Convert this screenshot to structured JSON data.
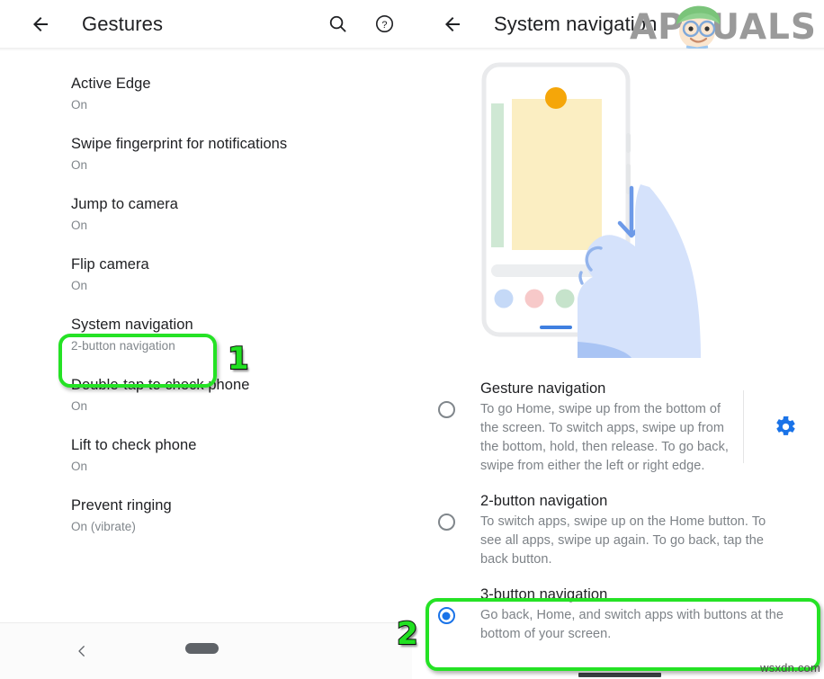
{
  "left_panel": {
    "appbar": {
      "back_icon": "back-arrow-icon",
      "title": "Gestures",
      "search_icon": "search-icon",
      "help_icon": "help-circle-icon"
    },
    "items": [
      {
        "title": "Active Edge",
        "subtitle": "On"
      },
      {
        "title": "Swipe fingerprint for notifications",
        "subtitle": "On"
      },
      {
        "title": "Jump to camera",
        "subtitle": "On"
      },
      {
        "title": "Flip camera",
        "subtitle": "On"
      },
      {
        "title": "System navigation",
        "subtitle": "2-button navigation"
      },
      {
        "title": "Double-tap to check phone",
        "subtitle": "On"
      },
      {
        "title": "Lift to check phone",
        "subtitle": "On"
      },
      {
        "title": "Prevent ringing",
        "subtitle": "On (vibrate)"
      }
    ],
    "bottom_nav": {
      "back_icon": "chevron-left-icon",
      "home_pill": "home-pill-icon"
    }
  },
  "right_panel": {
    "appbar": {
      "back_icon": "back-arrow-icon",
      "title": "System navigation"
    },
    "illustration": {
      "name": "phone-in-hand-illustration"
    },
    "options": [
      {
        "title": "Gesture navigation",
        "description": "To go Home, swipe up from the bottom of the screen. To switch apps, swipe up from the bottom, hold, then release. To go back, swipe from either the left or right edge.",
        "selected": false,
        "has_gear": true,
        "gear_icon": "gear-icon"
      },
      {
        "title": "2-button navigation",
        "description": "To switch apps, swipe up on the Home button. To see all apps, swipe up again. To go back, tap the back button.",
        "selected": false,
        "has_gear": false
      },
      {
        "title": "3-button navigation",
        "description": "Go back, Home, and switch apps with buttons at the bottom of your screen.",
        "selected": true,
        "has_gear": false
      }
    ]
  },
  "annotations": {
    "step_1": "1",
    "step_2": "2",
    "highlight_color": "#25e225",
    "step_number_color": "#21e021"
  },
  "watermarks": {
    "brand": "APPUALS",
    "site": "wsxdn.com"
  },
  "colors": {
    "accent_blue": "#1a73e8",
    "text_primary": "#202124",
    "text_secondary": "#80868b"
  }
}
